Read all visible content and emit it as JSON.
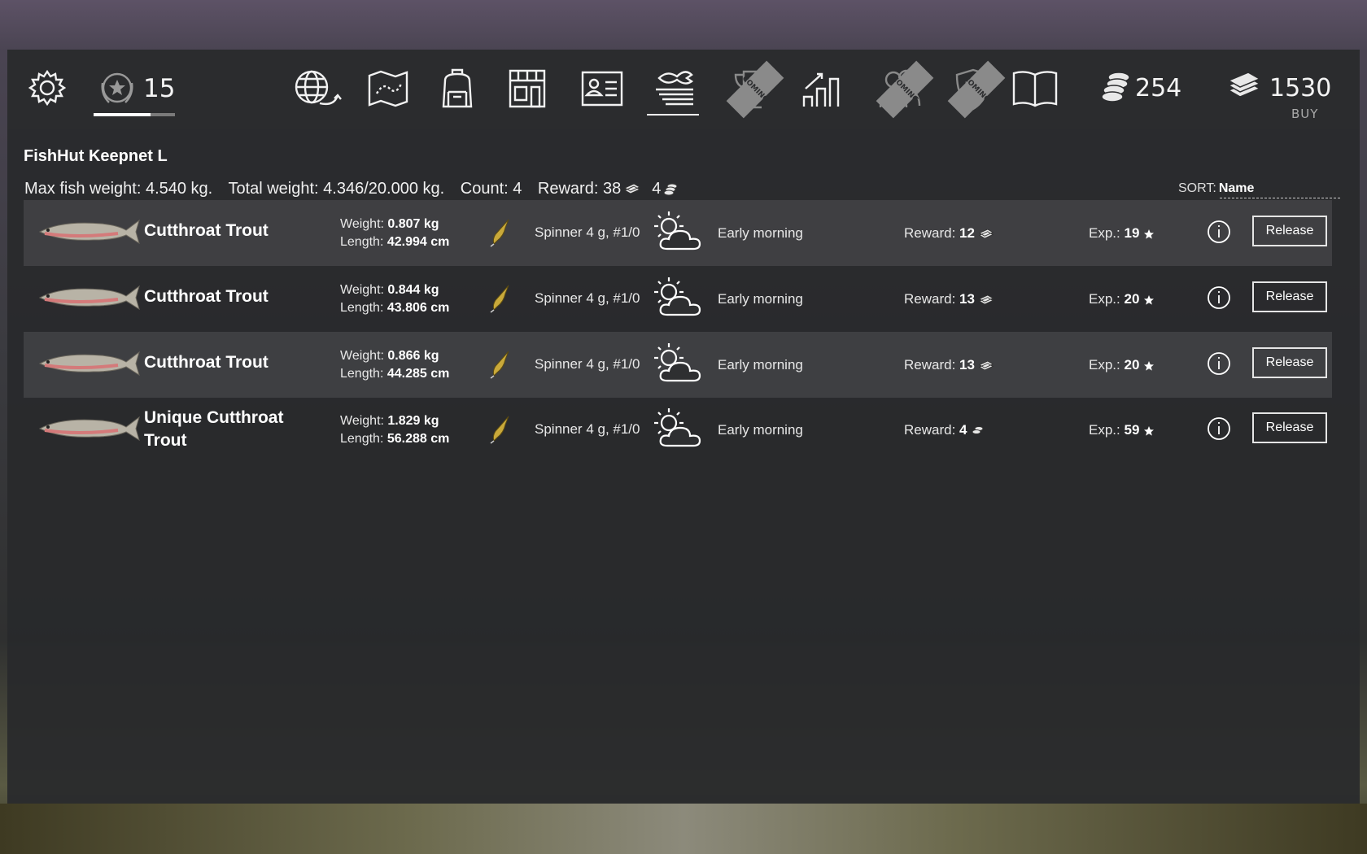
{
  "topbar": {
    "level": "15",
    "level_progress": 0.7,
    "coins": "254",
    "cash": "1530",
    "buy_label": "BUY",
    "icons": [
      "settings-icon",
      "level-badge-icon",
      "globe-travel-icon",
      "map-icon",
      "backpack-icon",
      "shop-icon",
      "license-icon",
      "keepnet-icon",
      "trophy-icon",
      "stats-icon",
      "friends-icon",
      "club-icon",
      "encyclopedia-icon",
      "coins-icon",
      "cash-icon"
    ],
    "coming_label": "COMING"
  },
  "keepnet": {
    "title": "FishHut Keepnet L",
    "max_weight": "Max fish weight: 4.540 kg.",
    "total_weight": "Total weight: 4.346/20.000 kg.",
    "count": "Count: 4",
    "reward_label": "Reward: 38",
    "reward_gold": "4",
    "sort_label": "SORT:",
    "sort_value": "Name"
  },
  "fish": [
    {
      "name": "Cutthroat Trout",
      "weight_label": "Weight:",
      "weight": "0.807 kg",
      "length_label": "Length:",
      "length": "42.994 cm",
      "lure": "Spinner 4 g, #1/0",
      "time": "Early morning",
      "reward_label": "Reward:",
      "reward": "12",
      "reward_currency": "cash-icon",
      "exp_label": "Exp.:",
      "exp": "19",
      "release": "Release"
    },
    {
      "name": "Cutthroat Trout",
      "weight_label": "Weight:",
      "weight": "0.844 kg",
      "length_label": "Length:",
      "length": "43.806 cm",
      "lure": "Spinner 4 g, #1/0",
      "time": "Early morning",
      "reward_label": "Reward:",
      "reward": "13",
      "reward_currency": "cash-icon",
      "exp_label": "Exp.:",
      "exp": "20",
      "release": "Release"
    },
    {
      "name": "Cutthroat Trout",
      "weight_label": "Weight:",
      "weight": "0.866 kg",
      "length_label": "Length:",
      "length": "44.285 cm",
      "lure": "Spinner 4 g, #1/0",
      "time": "Early morning",
      "reward_label": "Reward:",
      "reward": "13",
      "reward_currency": "cash-icon",
      "exp_label": "Exp.:",
      "exp": "20",
      "release": "Release"
    },
    {
      "name": "Unique Cutthroat Trout",
      "weight_label": "Weight:",
      "weight": "1.829 kg",
      "length_label": "Length:",
      "length": "56.288 cm",
      "lure": "Spinner 4 g, #1/0",
      "time": "Early morning",
      "reward_label": "Reward:",
      "reward": "4",
      "reward_currency": "coins-icon",
      "exp_label": "Exp.:",
      "exp": "59",
      "release": "Release"
    }
  ]
}
